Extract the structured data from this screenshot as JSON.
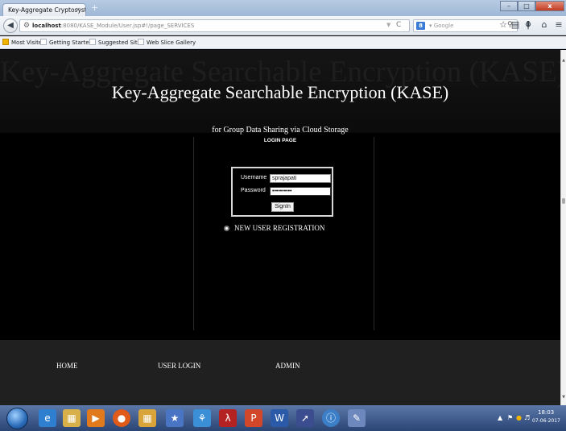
{
  "window": {
    "tab_title": "Key-Aggregate Cryptosystem",
    "tab_close": "×",
    "new_tab": "+",
    "minimize": "–",
    "maximize": "□",
    "close": "x"
  },
  "navbar": {
    "back_icon": "back-arrow-icon",
    "url_host": "localhost",
    "url_rest": ":8080/KASE_Module/User.jsp#!/page_SERVICES",
    "reload_glyph": "C",
    "search_engine_letter": "8",
    "search_placeholder": "Google",
    "toolbar_icons": [
      "search-icon",
      "bookmark-star-icon",
      "reading-list-icon",
      "download-icon",
      "home-icon",
      "menu-icon"
    ]
  },
  "bookmarks": {
    "items": [
      "Most Visited",
      "Getting Started",
      "Suggested Sites",
      "Web Slice Gallery"
    ]
  },
  "page": {
    "ghost_title": "Key-Aggregate Searchable Encryption (KASE)",
    "title": "Key-Aggregate Searchable Encryption (KASE)",
    "subtitle": "for Group Data Sharing via Cloud Storage",
    "login_page_label": "LOGIN PAGE",
    "login": {
      "username_label": "Username",
      "username_value": "sprajapati",
      "password_label": "Password",
      "password_value": "••••••••••",
      "signin_label": "SignIn"
    },
    "new_user_registration": "NEW USER REGISTRATION",
    "footer_links": [
      "HOME",
      "USER LOGIN",
      "ADMIN"
    ]
  },
  "taskbar": {
    "apps": [
      "internet-explorer-icon",
      "file-explorer-icon",
      "media-player-icon",
      "firefox-icon",
      "folder-icon",
      "star-app-icon",
      "network-app-icon",
      "pdf-reader-icon",
      "powerpoint-icon",
      "word-icon",
      "eclipse-icon",
      "help-icon",
      "paint-icon"
    ],
    "clock_time": "18:03",
    "clock_date": "07-06-2017"
  }
}
